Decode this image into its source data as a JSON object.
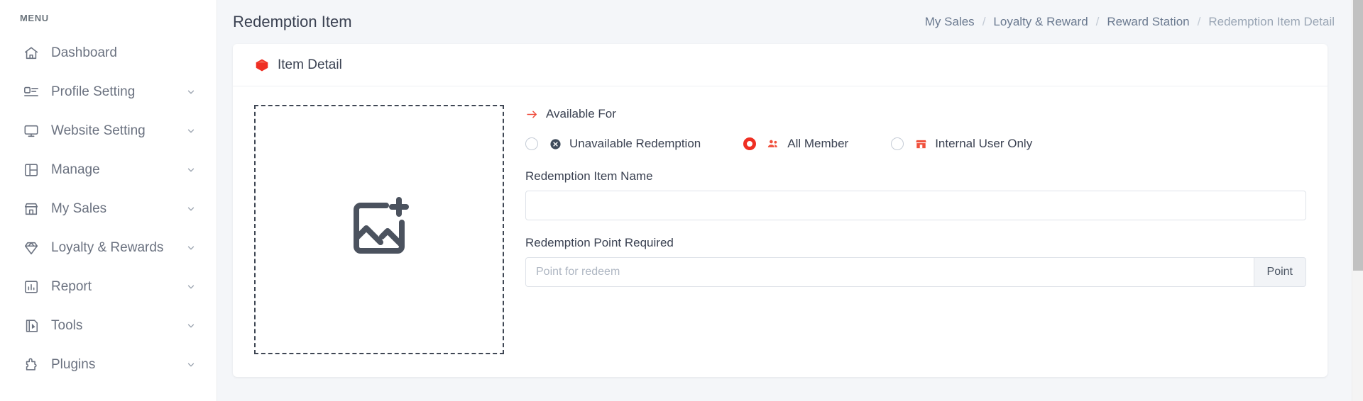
{
  "sidebar": {
    "menu_label": "MENU",
    "items": [
      {
        "label": "Dashboard",
        "icon": "home-icon",
        "has_caret": false
      },
      {
        "label": "Profile Setting",
        "icon": "profile-icon",
        "has_caret": true
      },
      {
        "label": "Website Setting",
        "icon": "monitor-icon",
        "has_caret": true
      },
      {
        "label": "Manage",
        "icon": "layout-icon",
        "has_caret": true
      },
      {
        "label": "My Sales",
        "icon": "store-icon",
        "has_caret": true
      },
      {
        "label": "Loyalty & Rewards",
        "icon": "diamond-icon",
        "has_caret": true
      },
      {
        "label": "Report",
        "icon": "bar-chart-icon",
        "has_caret": true
      },
      {
        "label": "Tools",
        "icon": "tools-icon",
        "has_caret": true
      },
      {
        "label": "Plugins",
        "icon": "plugin-icon",
        "has_caret": true
      }
    ]
  },
  "header": {
    "title": "Redemption Item",
    "breadcrumb": [
      {
        "label": "My Sales",
        "active": false
      },
      {
        "label": "Loyalty & Reward",
        "active": false
      },
      {
        "label": "Reward Station",
        "active": false
      },
      {
        "label": "Redemption Item Detail",
        "active": true
      }
    ],
    "separator": "/"
  },
  "card": {
    "icon": "red-box-icon",
    "title": "Item Detail",
    "upload": {
      "icon": "add-image-icon"
    },
    "available_for": {
      "icon": "arrow-right-icon",
      "label": "Available For",
      "options": [
        {
          "label": "Unavailable Redemption",
          "icon": "x-circle-icon",
          "icon_color": "#3f4b5b",
          "checked": false
        },
        {
          "label": "All Member",
          "icon": "people-icon",
          "icon_color": "#f0503c",
          "checked": true
        },
        {
          "label": "Internal User Only",
          "icon": "shop-icon",
          "icon_color": "#f0503c",
          "checked": false
        }
      ]
    },
    "fields": [
      {
        "label": "Redemption Item Name",
        "value": "",
        "placeholder": ""
      },
      {
        "label": "Redemption Point Required",
        "value": "",
        "placeholder": "Point for redeem",
        "addon": "Point"
      }
    ]
  },
  "colors": {
    "accent_red": "#ef2f23",
    "text_dark": "#3b4252",
    "muted": "#6b7280",
    "page_bg": "#f4f6f9"
  }
}
